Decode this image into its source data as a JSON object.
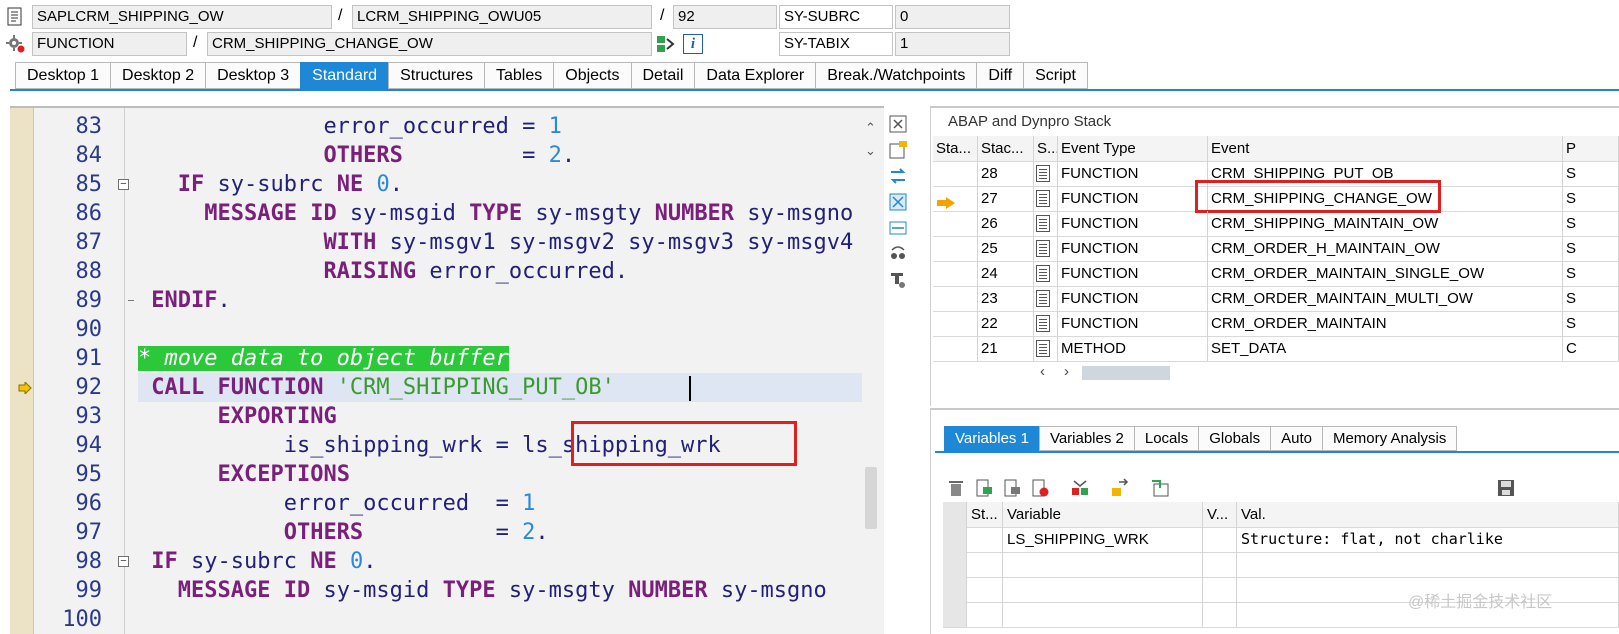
{
  "header": {
    "program": "SAPLCRM_SHIPPING_OW",
    "include": "LCRM_SHIPPING_OWU05",
    "line": "92",
    "event_type": "FUNCTION",
    "event_name": "CRM_SHIPPING_CHANGE_OW",
    "sysvars": [
      {
        "name": "SY-SUBRC",
        "value": "0"
      },
      {
        "name": "SY-TABIX",
        "value": "1"
      }
    ],
    "separator": "/"
  },
  "tabs": [
    "Desktop 1",
    "Desktop 2",
    "Desktop 3",
    "Standard",
    "Structures",
    "Tables",
    "Objects",
    "Detail",
    "Data Explorer",
    "Break./Watchpoints",
    "Diff",
    "Script"
  ],
  "active_tab": "Standard",
  "code": {
    "lines": [
      {
        "num": "83",
        "indent": "              ",
        "parts": [
          [
            "id",
            "error_occurred"
          ],
          [
            "id",
            " = "
          ],
          [
            "num",
            "1"
          ]
        ]
      },
      {
        "num": "84",
        "indent": "              ",
        "parts": [
          [
            "kw",
            "OTHERS"
          ],
          [
            "id",
            "         = "
          ],
          [
            "num",
            "2"
          ],
          [
            "id",
            "."
          ]
        ]
      },
      {
        "num": "85",
        "indent": "   ",
        "parts": [
          [
            "kw",
            "IF"
          ],
          [
            "id",
            " sy-subrc "
          ],
          [
            "kw",
            "NE"
          ],
          [
            "id",
            " "
          ],
          [
            "num",
            "0"
          ],
          [
            "id",
            "."
          ]
        ]
      },
      {
        "num": "86",
        "indent": "     ",
        "parts": [
          [
            "kw",
            "MESSAGE ID"
          ],
          [
            "id",
            " sy-msgid "
          ],
          [
            "kw",
            "TYPE"
          ],
          [
            "id",
            " sy-msgty "
          ],
          [
            "kw",
            "NUMBER"
          ],
          [
            "id",
            " sy-msgno"
          ]
        ]
      },
      {
        "num": "87",
        "indent": "              ",
        "parts": [
          [
            "kw",
            "WITH"
          ],
          [
            "id",
            " sy-msgv1 sy-msgv2 sy-msgv3 sy-msgv4"
          ]
        ]
      },
      {
        "num": "88",
        "indent": "              ",
        "parts": [
          [
            "kw",
            "RAISING"
          ],
          [
            "id",
            " error_occurred."
          ]
        ]
      },
      {
        "num": "89",
        "indent": " ",
        "parts": [
          [
            "kw",
            "ENDIF"
          ],
          [
            "id",
            "."
          ]
        ]
      },
      {
        "num": "90",
        "indent": "",
        "parts": []
      },
      {
        "num": "91",
        "indent": "",
        "parts": [
          [
            "comment",
            "* move data to object buffer"
          ]
        ]
      },
      {
        "num": "92",
        "indent": " ",
        "parts": [
          [
            "kw",
            "CALL FUNCTION"
          ],
          [
            "id",
            " "
          ],
          [
            "str",
            "'CRM_SHIPPING_PUT_OB'"
          ]
        ]
      },
      {
        "num": "93",
        "indent": "      ",
        "parts": [
          [
            "kw",
            "EXPORTING"
          ]
        ]
      },
      {
        "num": "94",
        "indent": "           ",
        "parts": [
          [
            "id",
            "is_shipping_wrk = ls_shipping_wrk"
          ]
        ]
      },
      {
        "num": "95",
        "indent": "      ",
        "parts": [
          [
            "kw",
            "EXCEPTIONS"
          ]
        ]
      },
      {
        "num": "96",
        "indent": "           ",
        "parts": [
          [
            "id",
            "error_occurred  = "
          ],
          [
            "num",
            "1"
          ]
        ]
      },
      {
        "num": "97",
        "indent": "           ",
        "parts": [
          [
            "kw",
            "OTHERS"
          ],
          [
            "id",
            "          = "
          ],
          [
            "num",
            "2"
          ],
          [
            "id",
            "."
          ]
        ]
      },
      {
        "num": "98",
        "indent": " ",
        "parts": [
          [
            "kw",
            "IF"
          ],
          [
            "id",
            " sy-subrc "
          ],
          [
            "kw",
            "NE"
          ],
          [
            "id",
            " "
          ],
          [
            "num",
            "0"
          ],
          [
            "id",
            "."
          ]
        ]
      },
      {
        "num": "99",
        "indent": "   ",
        "parts": [
          [
            "kw",
            "MESSAGE ID"
          ],
          [
            "id",
            " sy-msgid "
          ],
          [
            "kw",
            "TYPE"
          ],
          [
            "id",
            " sy-msgty "
          ],
          [
            "kw",
            "NUMBER"
          ],
          [
            "id",
            " sy-msgno"
          ]
        ]
      },
      {
        "num": "100",
        "indent": "",
        "parts": []
      }
    ],
    "current_line": "92"
  },
  "stack": {
    "title": "ABAP and Dynpro Stack",
    "columns": [
      "Sta...",
      "Stac...",
      "S...",
      "Event Type",
      "Event",
      "P"
    ],
    "rows": [
      {
        "level": "28",
        "type": "FUNCTION",
        "event": "CRM_SHIPPING_PUT_OB",
        "current": false
      },
      {
        "level": "27",
        "type": "FUNCTION",
        "event": "CRM_SHIPPING_CHANGE_OW",
        "current": true
      },
      {
        "level": "26",
        "type": "FUNCTION",
        "event": "CRM_SHIPPING_MAINTAIN_OW",
        "current": false
      },
      {
        "level": "25",
        "type": "FUNCTION",
        "event": "CRM_ORDER_H_MAINTAIN_OW",
        "current": false
      },
      {
        "level": "24",
        "type": "FUNCTION",
        "event": "CRM_ORDER_MAINTAIN_SINGLE_OW",
        "current": false
      },
      {
        "level": "23",
        "type": "FUNCTION",
        "event": "CRM_ORDER_MAINTAIN_MULTI_OW",
        "current": false
      },
      {
        "level": "22",
        "type": "FUNCTION",
        "event": "CRM_ORDER_MAINTAIN",
        "current": false
      },
      {
        "level": "21",
        "type": "METHOD",
        "event": "SET_DATA",
        "current": false
      }
    ],
    "row_tail": [
      "S",
      "S",
      "S",
      "S",
      "S",
      "S",
      "S",
      "C"
    ]
  },
  "var_tabs": [
    "Variables 1",
    "Variables 2",
    "Locals",
    "Globals",
    "Auto",
    "Memory Analysis"
  ],
  "var_active": "Variables 1",
  "vars": {
    "columns": [
      "St...",
      "Variable",
      "V...",
      "Val."
    ],
    "rows": [
      {
        "name": "LS_SHIPPING_WRK",
        "value": "Structure: flat, not charlike"
      }
    ]
  },
  "watermark": "@稀土掘金技术社区",
  "colors": {
    "accent": "#1e87d6",
    "highlight": "#e02020",
    "comment_bg": "#2bc83a"
  }
}
